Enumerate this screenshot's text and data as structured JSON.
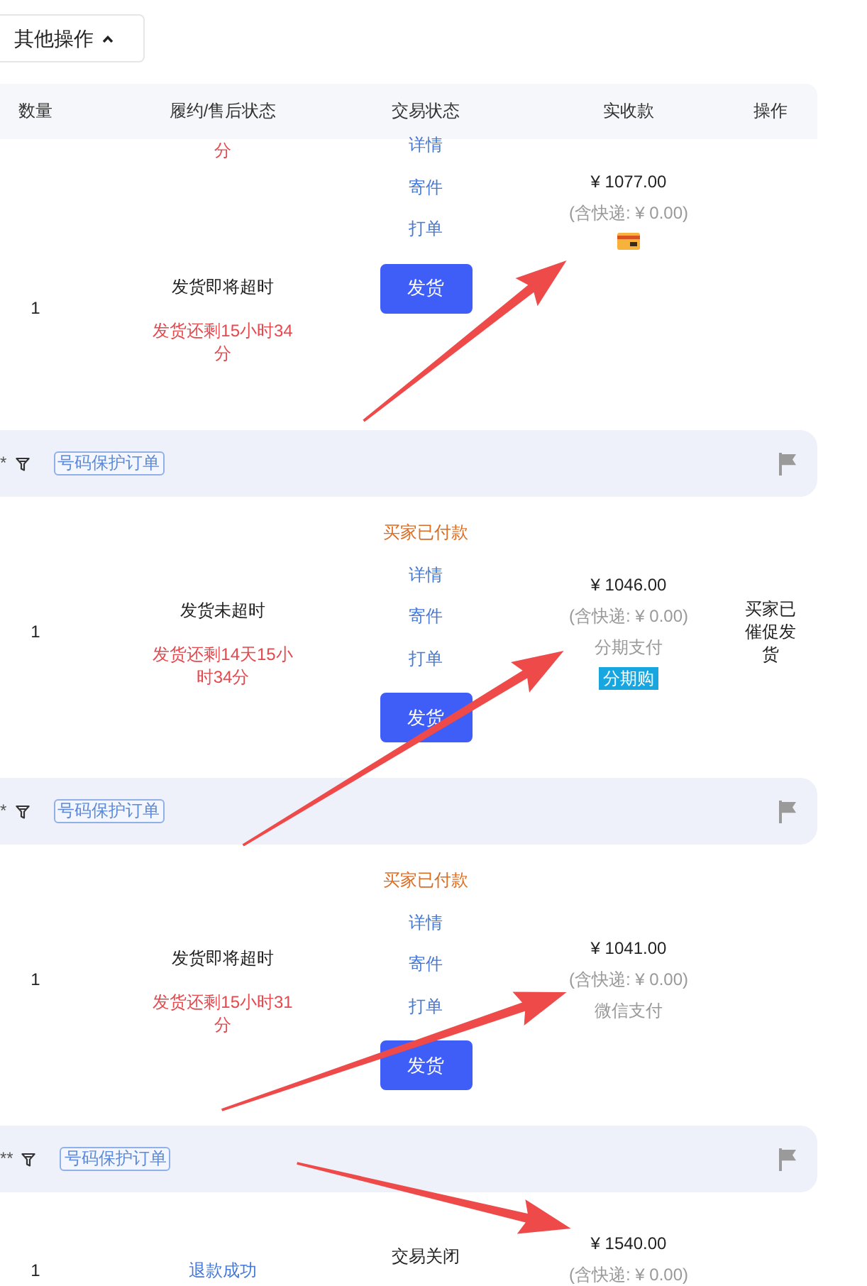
{
  "toolbar": {
    "more_actions": {
      "label": "其他操作",
      "expanded": true
    }
  },
  "table": {
    "columns": [
      "数量",
      "履约/售后状态",
      "交易状态",
      "实收款",
      "操作"
    ],
    "orders": [
      {
        "items": [
          {
            "status_lines": [
              {
                "kind": "countdown",
                "text": "分"
              }
            ]
          },
          {
            "quantity": "1",
            "status_lines": [
              {
                "kind": "text",
                "text": "发货即将超时"
              },
              {
                "kind": "countdown",
                "text": "发货还剩15小时34分"
              }
            ]
          }
        ],
        "trade": [
          {
            "kind": "link",
            "text": "详情"
          },
          {
            "kind": "link",
            "text": "寄件"
          },
          {
            "kind": "link",
            "text": "打单"
          },
          {
            "kind": "button",
            "text": "发货"
          }
        ],
        "payment": [
          {
            "kind": "amount",
            "text": "¥ 1077.00"
          },
          {
            "kind": "shipping",
            "text": "(含快递: ¥ 0.00)"
          },
          {
            "kind": "card_icon"
          }
        ],
        "arrow": true
      },
      {
        "header": {
          "buyer": "*",
          "tag": "号码保护订单"
        },
        "items": [
          {
            "quantity": "1",
            "status_lines": [
              {
                "kind": "text",
                "text": "发货未超时"
              },
              {
                "kind": "countdown",
                "text": "发货还剩14天15小时34分"
              }
            ]
          }
        ],
        "trade": [
          {
            "kind": "alert",
            "text": "买家已付款"
          },
          {
            "kind": "link",
            "text": "详情"
          },
          {
            "kind": "link",
            "text": "寄件"
          },
          {
            "kind": "link",
            "text": "打单"
          },
          {
            "kind": "button",
            "text": "发货"
          }
        ],
        "payment": [
          {
            "kind": "amount",
            "text": "¥ 1046.00"
          },
          {
            "kind": "shipping",
            "text": "(含快递: ¥ 0.00)"
          },
          {
            "kind": "method",
            "text": "分期支付"
          },
          {
            "kind": "badge",
            "text": "分期购"
          }
        ],
        "operation_note": "买家已催促发货",
        "arrow": true
      },
      {
        "header": {
          "buyer": "*",
          "tag": "号码保护订单"
        },
        "items": [
          {
            "quantity": "1",
            "status_lines": [
              {
                "kind": "text",
                "text": "发货即将超时"
              },
              {
                "kind": "countdown",
                "text": "发货还剩15小时31分"
              }
            ]
          }
        ],
        "trade": [
          {
            "kind": "alert",
            "text": "买家已付款"
          },
          {
            "kind": "link",
            "text": "详情"
          },
          {
            "kind": "link",
            "text": "寄件"
          },
          {
            "kind": "link",
            "text": "打单"
          },
          {
            "kind": "button",
            "text": "发货"
          }
        ],
        "payment": [
          {
            "kind": "amount",
            "text": "¥ 1041.00"
          },
          {
            "kind": "shipping",
            "text": "(含快递: ¥ 0.00)"
          },
          {
            "kind": "method",
            "text": "微信支付"
          }
        ],
        "arrow": true
      },
      {
        "header": {
          "buyer": "**",
          "tag": "号码保护订单"
        },
        "items": [
          {
            "quantity": "1",
            "status_lines": [
              {
                "kind": "link",
                "text": "退款成功"
              }
            ]
          }
        ],
        "trade": [
          {
            "kind": "text",
            "text": "交易关闭"
          }
        ],
        "payment": [
          {
            "kind": "amount",
            "text": "¥ 1540.00"
          },
          {
            "kind": "shipping",
            "text": "(含快递: ¥ 0.00)"
          }
        ],
        "arrow": true
      }
    ]
  }
}
